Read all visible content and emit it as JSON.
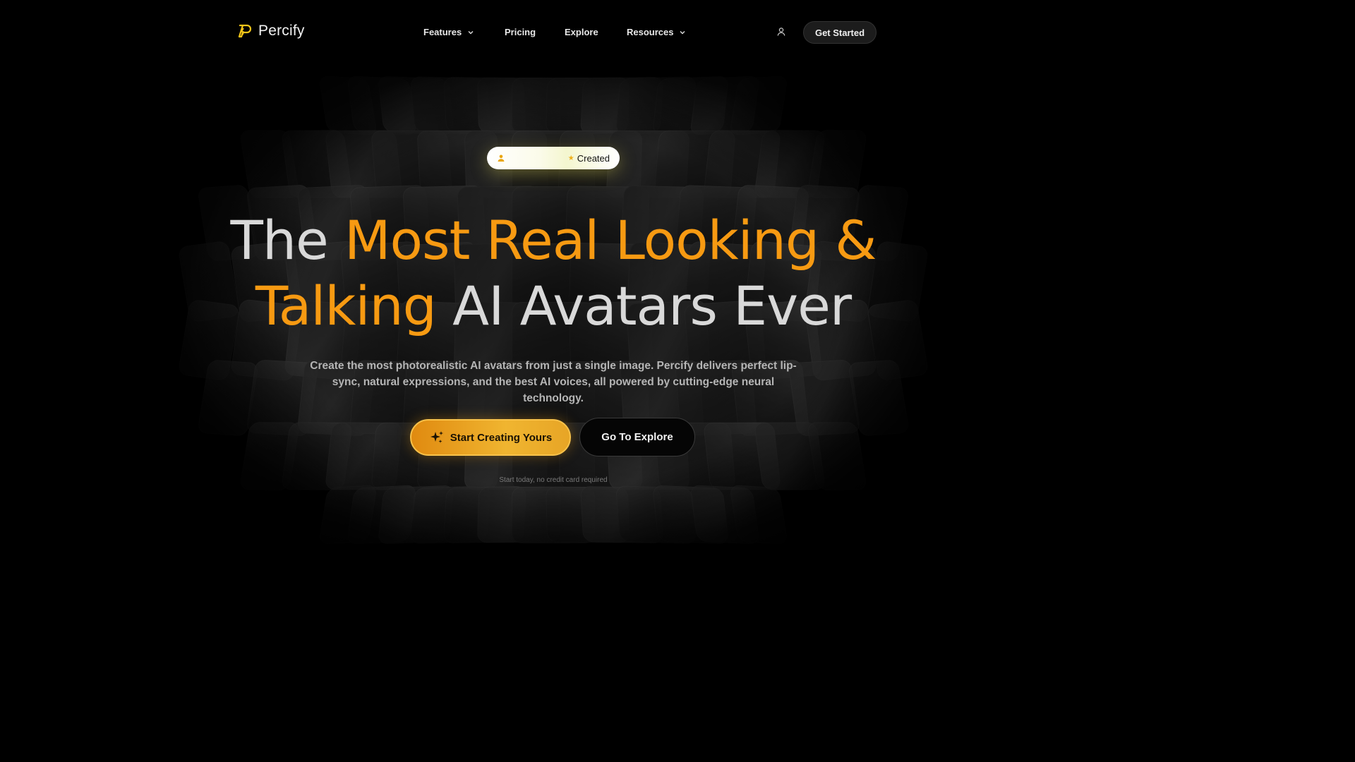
{
  "brand": {
    "name": "Percify",
    "accent": "#f79a12"
  },
  "nav": {
    "items": [
      {
        "label": "Features",
        "has_dropdown": true
      },
      {
        "label": "Pricing",
        "has_dropdown": false
      },
      {
        "label": "Explore",
        "has_dropdown": false
      },
      {
        "label": "Resources",
        "has_dropdown": true
      }
    ],
    "account_icon": "user-icon",
    "get_started_label": "Get Started"
  },
  "badge": {
    "icon": "user-icon",
    "star_icon": "star-icon",
    "label": "Created"
  },
  "hero": {
    "line1_plain": "The ",
    "line1_accent": "Most Real Looking &",
    "line2_accent": "Talking",
    "line2_plain": " AI Avatars Ever",
    "subtitle_line1": "Create the most photorealistic AI avatars from just a single image. Percify delivers perfect lip-",
    "subtitle_line2": "sync, natural expressions, and the best AI voices, all powered by cutting-edge neural technology.",
    "primary_cta": "Start Creating Yours",
    "primary_cta_icon": "sparkle-icon",
    "secondary_cta": "Go To Explore",
    "note": "Start today, no credit card required"
  }
}
